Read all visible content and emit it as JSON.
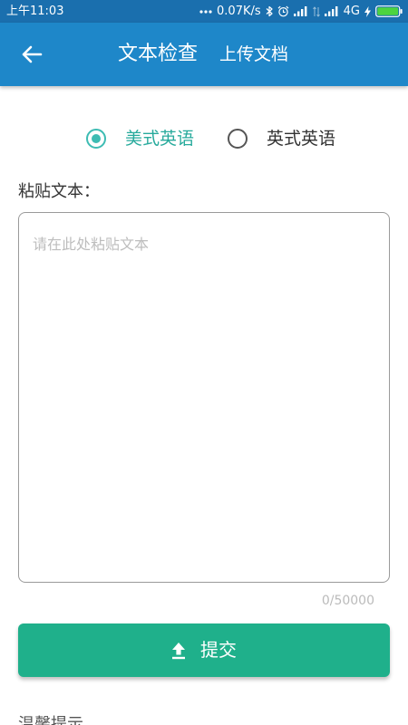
{
  "status_bar": {
    "time": "上午11:03",
    "network_speed": "0.07K/s",
    "network_type": "4G",
    "icons": [
      "more-dots-icon",
      "bluetooth-icon",
      "alarm-icon",
      "signal-icon",
      "data-arrows-icon",
      "signal-icon",
      "charging-icon",
      "battery-icon"
    ],
    "signal_levels": [
      4,
      4
    ],
    "battery_level": 1.0
  },
  "header": {
    "back_icon": "arrow-left-icon",
    "title": "文本检查",
    "upload_link": "上传文档"
  },
  "dialect": {
    "options": [
      {
        "label": "美式英语",
        "selected": true
      },
      {
        "label": "英式英语",
        "selected": false
      }
    ]
  },
  "paste": {
    "label": "粘贴文本：",
    "value": "",
    "placeholder": "请在此处粘贴文本",
    "counter": "0/50000"
  },
  "submit": {
    "icon": "upload-icon",
    "label": "提交"
  },
  "tips": {
    "title": "温馨提示"
  },
  "colors": {
    "status_bg": "#1a6fae",
    "header_bg": "#1e87c9",
    "accent": "#3dbcb3",
    "accent_text": "#27aa9c",
    "submit_bg": "#1fb08b",
    "battery": "#4cd43f"
  }
}
